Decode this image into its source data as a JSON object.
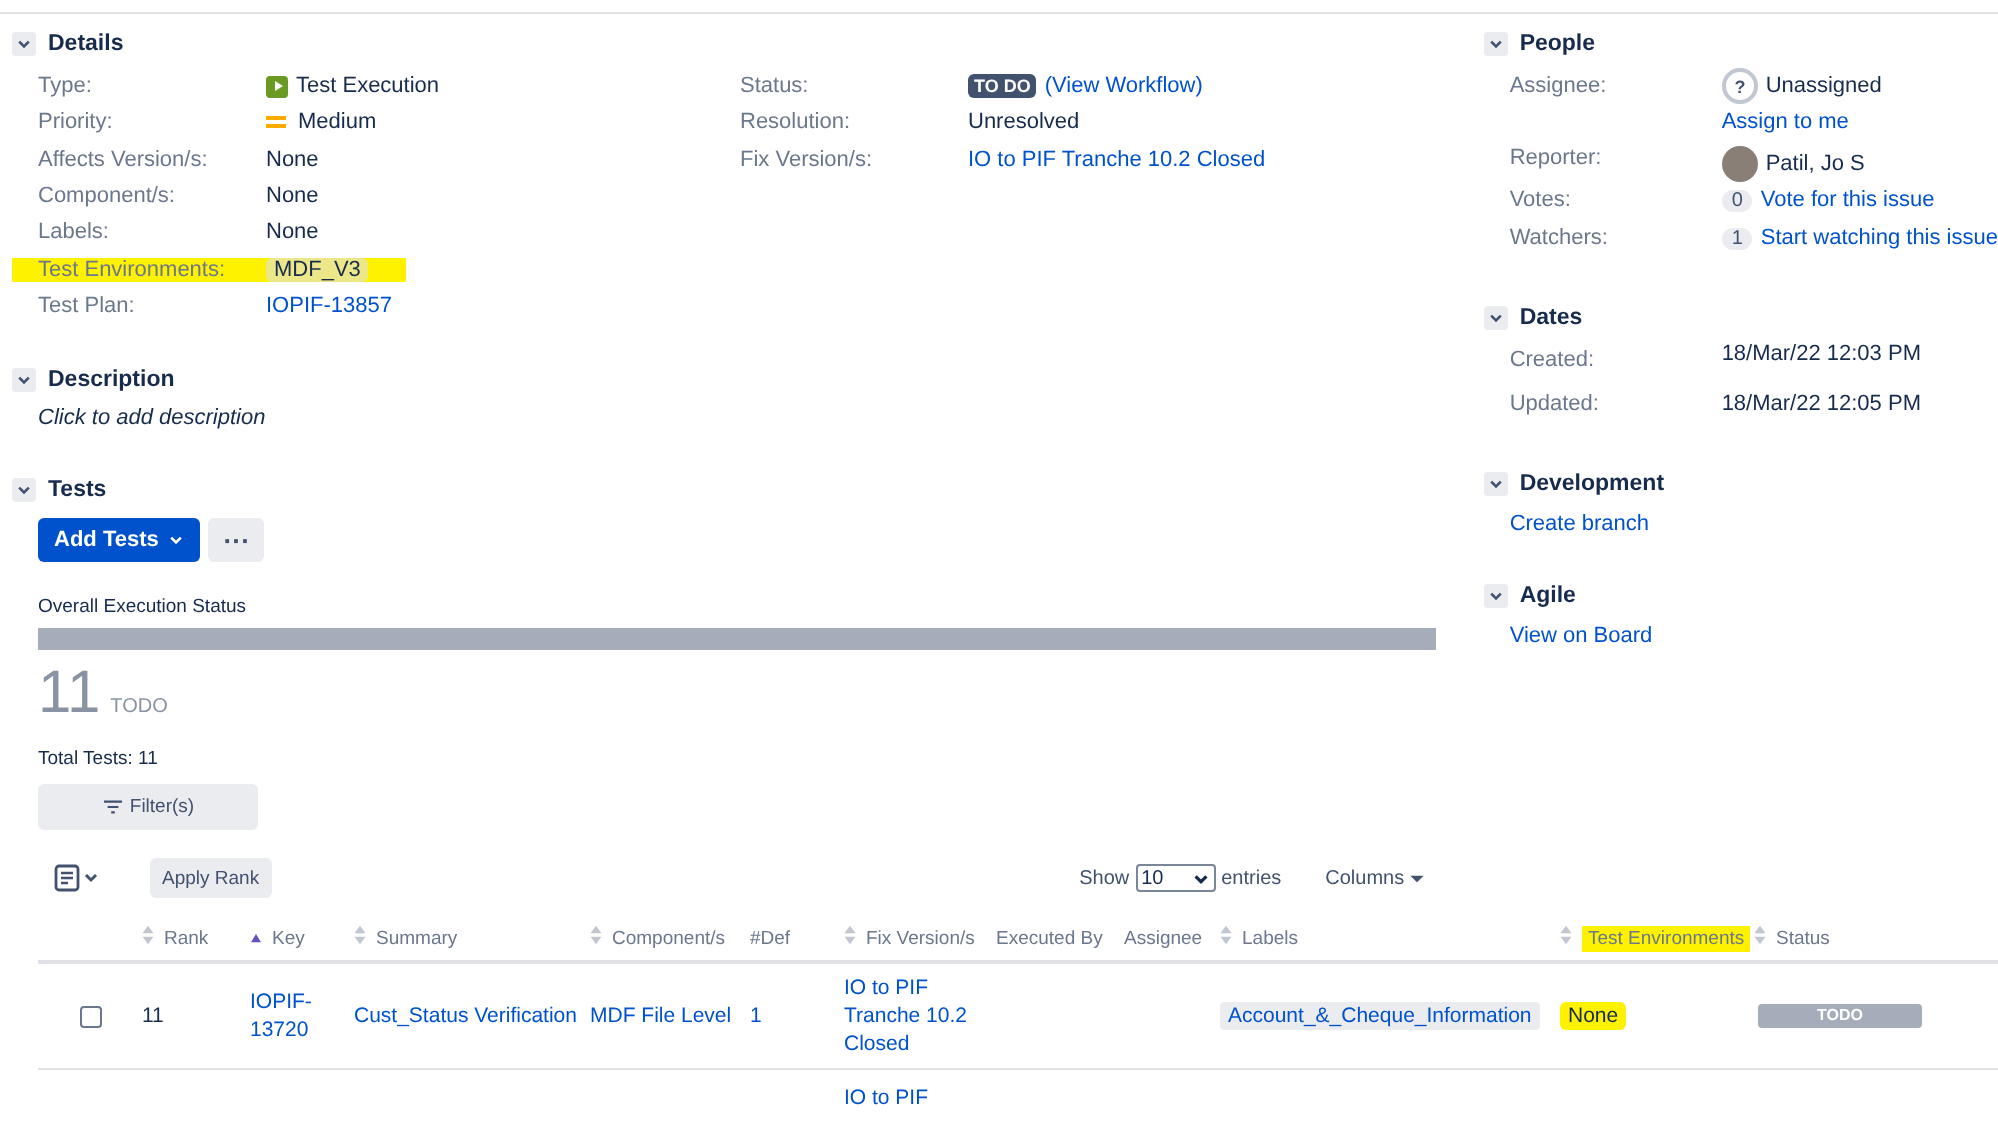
{
  "details": {
    "title": "Details",
    "expanded": true,
    "left": [
      {
        "label": "Type:",
        "value": "Test Execution",
        "kind": "type",
        "highlighted": false
      },
      {
        "label": "Priority:",
        "value": "Medium",
        "kind": "priority",
        "highlighted": false
      },
      {
        "label": "Affects Version/s:",
        "value": "None",
        "kind": "text",
        "highlighted": false
      },
      {
        "label": "Component/s:",
        "value": "None",
        "kind": "text",
        "highlighted": false
      },
      {
        "label": "Labels:",
        "value": "None",
        "kind": "text",
        "highlighted": false
      },
      {
        "label": "Test Environments:",
        "value": "MDF_V3",
        "kind": "tag",
        "highlighted": true
      },
      {
        "label": "Test Plan:",
        "value": "IOPIF-13857",
        "kind": "link",
        "highlighted": false
      }
    ],
    "right": [
      {
        "label": "Status:",
        "value": "TO DO",
        "link": "(View Workflow)",
        "kind": "status",
        "highlighted": false
      },
      {
        "label": "Resolution:",
        "value": "Unresolved",
        "kind": "text",
        "highlighted": false
      },
      {
        "label": "Fix Version/s:",
        "value": "IO to PIF Tranche 10.2 Closed",
        "kind": "link",
        "highlighted": false
      }
    ]
  },
  "description": {
    "title": "Description",
    "expanded": true,
    "placeholder": "Click to add description"
  },
  "tests": {
    "title": "Tests",
    "expanded": true,
    "add_button": "Add Tests",
    "more_button": "···",
    "status_title": "Overall Execution Status",
    "status_bar": [
      {
        "level": 1,
        "color": "#a5adba"
      }
    ],
    "count": "11",
    "count_label": "TODO",
    "total": "Total Tests: 11",
    "filter_button": "Filter(s)",
    "apply_rank": "Apply Rank",
    "show_label": "Show",
    "page_size": "10",
    "entries_label": "entries",
    "columns_button": "Columns",
    "columns": [
      {
        "label": "Rank",
        "sortable": true,
        "sorted": false,
        "highlighted": false
      },
      {
        "label": "Key",
        "sortable": true,
        "sorted": true,
        "highlighted": false
      },
      {
        "label": "Summary",
        "sortable": true,
        "sorted": false,
        "highlighted": false
      },
      {
        "label": "Component/s",
        "sortable": true,
        "sorted": false,
        "highlighted": false
      },
      {
        "label": "#Def",
        "sortable": false,
        "sorted": false,
        "highlighted": false
      },
      {
        "label": "Fix Version/s",
        "sortable": true,
        "sorted": false,
        "highlighted": false
      },
      {
        "label": "Executed By",
        "sortable": false,
        "sorted": false,
        "highlighted": false
      },
      {
        "label": "Assignee",
        "sortable": false,
        "sorted": false,
        "highlighted": false
      },
      {
        "label": "Labels",
        "sortable": true,
        "sorted": false,
        "highlighted": false
      },
      {
        "label": "Test Environments",
        "sortable": true,
        "sorted": false,
        "highlighted": true
      },
      {
        "label": "Status",
        "sortable": true,
        "sorted": false,
        "highlighted": false
      }
    ],
    "rows": [
      {
        "checked": false,
        "rank": "11",
        "key": "IOPIF-13720",
        "summary": "Cust_Status Verification",
        "component": "MDF File Level",
        "defects": "1",
        "fix_version": "IO to PIF Tranche 10.2 Closed",
        "label": "Account_&_Cheque_Information",
        "test_environment": {
          "text": "None",
          "highlighted": true
        },
        "status": {
          "text": "TODO",
          "color": "#a5adba"
        }
      },
      {
        "fix_version": "IO to PIF"
      }
    ]
  },
  "people": {
    "title": "People",
    "expanded": true,
    "assignee": {
      "label": "Assignee:",
      "avatar_glyph": "?",
      "value": "Unassigned",
      "link": "Assign to me"
    },
    "reporter": {
      "label": "Reporter:",
      "value": "Patil, Jo S"
    },
    "votes": {
      "label": "Votes:",
      "count": "0",
      "link": "Vote for this issue"
    },
    "watchers": {
      "label": "Watchers:",
      "count": "1",
      "link": "Start watching this issue"
    }
  },
  "dates": {
    "title": "Dates",
    "expanded": true,
    "items": [
      {
        "label": "Created:",
        "value": "18/Mar/22 12:03 PM"
      },
      {
        "label": "Updated:",
        "value": "18/Mar/22 12:05 PM"
      }
    ]
  },
  "development": {
    "title": "Development",
    "expanded": true,
    "link": "Create branch"
  },
  "agile": {
    "title": "Agile",
    "expanded": true,
    "link": "View on Board"
  }
}
